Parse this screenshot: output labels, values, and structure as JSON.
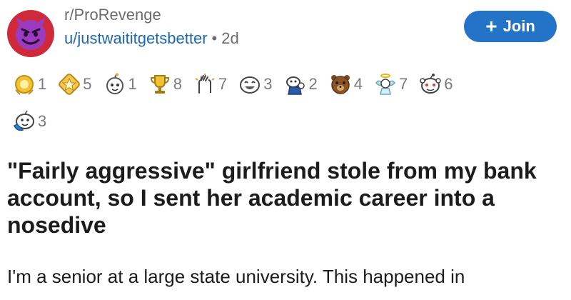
{
  "post": {
    "subreddit": "r/ProRevenge",
    "username": "u/justwaititgetsbetter",
    "separator": "•",
    "age": "2d",
    "join_label": "Join",
    "join_icon": "plus-icon",
    "title": "\"Fairly aggressive\" girlfriend stole from my bank account, so I sent her academic career into a nosedive",
    "body_first_line": "I'm a senior at a large state university. This happened in"
  },
  "awards": [
    {
      "icon": "helpful-award-icon",
      "count": "1"
    },
    {
      "icon": "star-badge-award-icon",
      "count": "5"
    },
    {
      "icon": "wholesome-award-icon",
      "count": "1"
    },
    {
      "icon": "trophy-award-icon",
      "count": "8"
    },
    {
      "icon": "bravo-hands-award-icon",
      "count": "7"
    },
    {
      "icon": "laughing-award-icon",
      "count": "3"
    },
    {
      "icon": "snoo-award-icon",
      "count": "2"
    },
    {
      "icon": "bear-award-icon",
      "count": "4"
    },
    {
      "icon": "angel-award-icon",
      "count": "7"
    },
    {
      "icon": "snoo-face-award-icon",
      "count": "6"
    },
    {
      "icon": "snoo-hug-award-icon",
      "count": "3"
    }
  ],
  "colors": {
    "join_button": "#2374c7",
    "username": "#1d68b0",
    "meta_text": "#6d6d6d",
    "avatar": "#cf2a3a"
  }
}
